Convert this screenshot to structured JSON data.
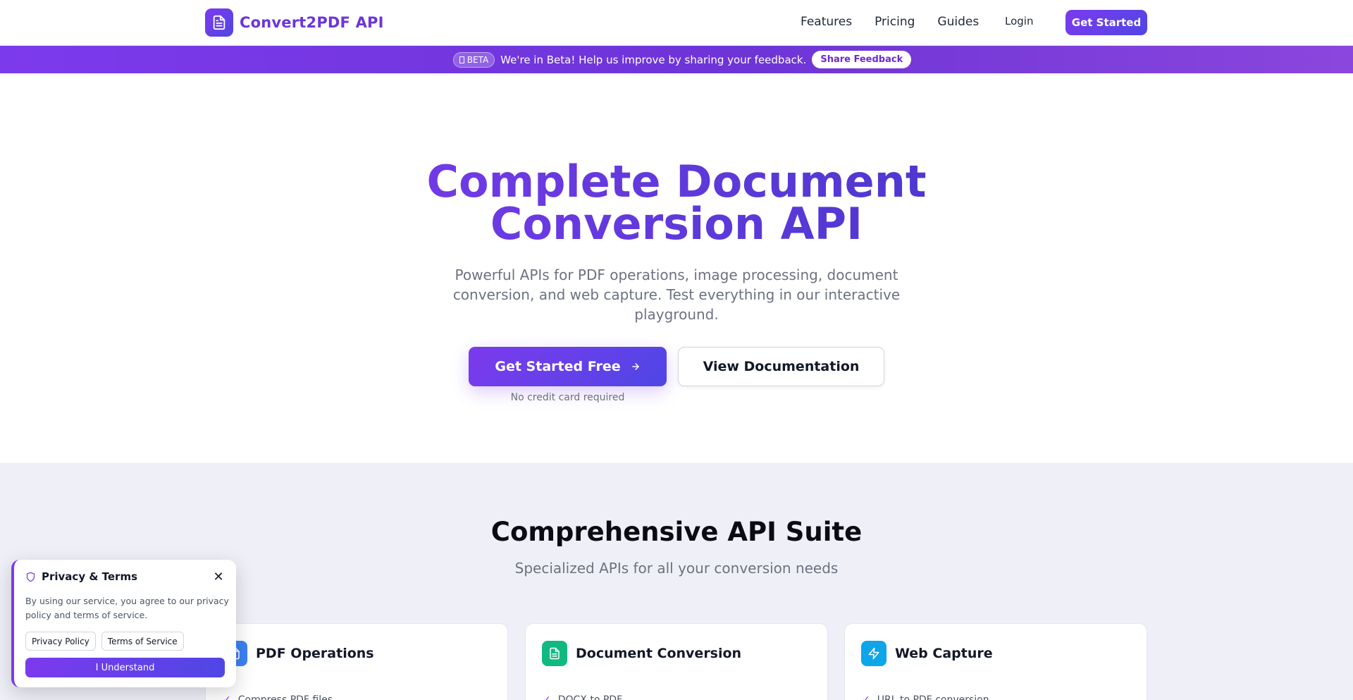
{
  "nav": {
    "brand": "Convert2PDF API",
    "brand_icon": "document-icon",
    "links": [
      "Features",
      "Pricing",
      "Guides"
    ],
    "login": "Login",
    "cta": "Get Started"
  },
  "beta": {
    "badge": "BETA",
    "message": "We're in Beta! Help us improve by sharing your feedback.",
    "button": "Share Feedback"
  },
  "hero": {
    "title_line1": "Complete Document",
    "title_line2": "Conversion API",
    "subtitle": "Powerful APIs for PDF operations, image processing, document conversion, and web capture. Test everything in our interactive playground.",
    "primary_button": "Get Started Free",
    "secondary_button": "View Documentation",
    "note": "No credit card required"
  },
  "features": {
    "title": "Comprehensive API Suite",
    "subtitle": "Specialized APIs for all your conversion needs",
    "cards": [
      {
        "title": "PDF Operations",
        "icon": "pdf-icon",
        "color": "#3b82f6",
        "item": "Compress PDF files"
      },
      {
        "title": "Document Conversion",
        "icon": "document-icon",
        "color": "#10b981",
        "item": "DOCX to PDF"
      },
      {
        "title": "Web Capture",
        "icon": "lightning-icon",
        "color": "#0ea5e9",
        "item": "URL to PDF conversion"
      }
    ]
  },
  "privacy": {
    "title": "Privacy & Terms",
    "text": "By using our service, you agree to our privacy policy and terms of service.",
    "privacy_link": "Privacy Policy",
    "terms_link": "Terms of Service",
    "accept": "I Understand"
  },
  "colors": {
    "accent": "#7c3aed",
    "accent_dark": "#4f46e5",
    "section_bg": "#eff0f7"
  }
}
